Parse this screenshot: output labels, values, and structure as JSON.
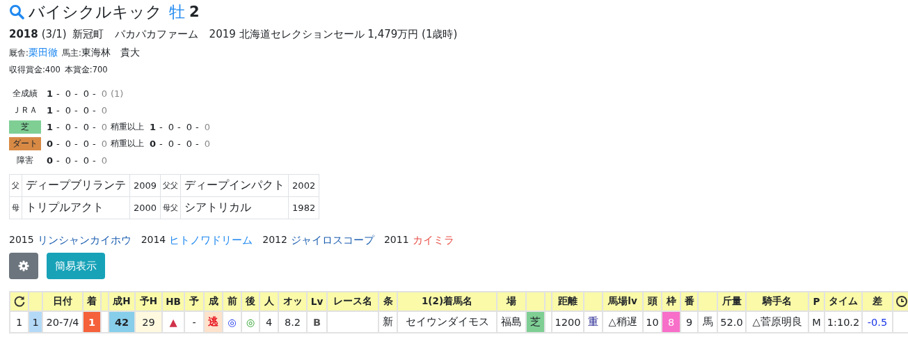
{
  "header": {
    "name": "バイシクルキック",
    "sex": "牡",
    "age": "2"
  },
  "profile": {
    "year": "2018",
    "birthday": "(3/1)",
    "town": "新冠町",
    "farm": "パカパカファーム",
    "sale": "2019 北海道セレクションセール 1,479万円 (1歳時)"
  },
  "stable": {
    "trainer_label": "厩舎:",
    "trainer": "栗田徹",
    "owner_label": "馬主:",
    "owner": "東海林　貴大"
  },
  "prize": {
    "earned": "収得賞金:400",
    "total": "本賞金:700"
  },
  "record_separator": "-",
  "records": [
    {
      "label": "全成績",
      "kind": "plain",
      "counts": [
        "1",
        "0",
        "0",
        "0"
      ],
      "note": "(1)"
    },
    {
      "label": "ＪＲＡ",
      "kind": "plain",
      "counts": [
        "1",
        "0",
        "0",
        "0"
      ]
    },
    {
      "label": "芝",
      "kind": "turf",
      "counts": [
        "1",
        "0",
        "0",
        "0"
      ],
      "heavy": {
        "label": "稍重以上",
        "counts": [
          "1",
          "0",
          "0",
          "0"
        ]
      }
    },
    {
      "label": "ダート",
      "kind": "dirt",
      "counts": [
        "0",
        "0",
        "0",
        "0"
      ],
      "heavy": {
        "label": "稍重以上",
        "counts": [
          "0",
          "0",
          "0",
          "0"
        ]
      }
    },
    {
      "label": "障害",
      "kind": "plain",
      "counts": [
        "0",
        "0",
        "0",
        "0"
      ]
    }
  ],
  "pedigree": [
    [
      "父",
      "ディープブリランテ",
      "2009",
      "父父",
      "ディープインパクト",
      "2002"
    ],
    [
      "母",
      "トリプルアクト",
      "2000",
      "母父",
      "シアトリカル",
      "1982"
    ]
  ],
  "siblings": [
    {
      "year": "2015",
      "name": "リンシャンカイホウ",
      "color": "#1d5fb0"
    },
    {
      "year": "2014",
      "name": "ヒトノワドリーム",
      "color": "#1e88f0"
    },
    {
      "year": "2012",
      "name": "ジャイロスコープ",
      "color": "#1d5fb0"
    },
    {
      "year": "2011",
      "name": "カイミラ",
      "color": "#e8524a"
    }
  ],
  "buttons": {
    "simple": "簡易表示"
  },
  "table": {
    "columns": [
      {
        "kind": "reload"
      },
      {},
      {
        "label": "日付"
      },
      {
        "label": "着"
      },
      {},
      {
        "label": "成H"
      },
      {
        "label": "予H"
      },
      {
        "label": "HB"
      },
      {
        "label": "予"
      },
      {
        "label": "成"
      },
      {
        "label": "前"
      },
      {
        "label": "後"
      },
      {
        "label": "人"
      },
      {
        "label": "オッ"
      },
      {
        "label": "Lv"
      },
      {
        "label": "レース名"
      },
      {
        "label": "条"
      },
      {
        "label": "1(2)着馬名"
      },
      {
        "label": "場"
      },
      {},
      {},
      {
        "label": "距離"
      },
      {},
      {
        "label": "馬場lv"
      },
      {
        "label": "頭"
      },
      {
        "label": "枠"
      },
      {
        "label": "番"
      },
      {},
      {
        "label": "斤量"
      },
      {
        "label": "騎手名"
      },
      {
        "label": "P"
      },
      {
        "label": "タイム"
      },
      {
        "label": "差"
      },
      {
        "kind": "clock"
      }
    ],
    "rows": [
      [
        {
          "text": "1"
        },
        {
          "text": "1",
          "color": "#b3d9f7"
        },
        {
          "text": "20-7/4"
        },
        {
          "text": "1",
          "color": "#f4613a",
          "kind": "light"
        },
        {},
        {
          "text": "42",
          "color": "#87ceea",
          "kind": "strong"
        },
        {
          "text": "29",
          "color": "#fff9e0"
        },
        {
          "text": "▲",
          "kind": "red"
        },
        {
          "text": "-"
        },
        {
          "text": "逃",
          "color": "#fde2cc",
          "kind": "alert"
        },
        {
          "text": "◎",
          "kind": "blue"
        },
        {
          "text": "◎",
          "kind": "green"
        },
        {
          "text": "4"
        },
        {
          "text": "8.2"
        },
        {
          "text": "B",
          "kind": "muted"
        },
        {},
        {
          "text": "新"
        },
        {
          "text": "セイウンダイモス"
        },
        {
          "text": "福島"
        },
        {
          "text": "芝",
          "color": "#7fcf95"
        },
        {},
        {
          "text": "1200"
        },
        {
          "text": "重",
          "kind": "navy"
        },
        {
          "text": "△稍遅"
        },
        {
          "text": "10"
        },
        {
          "text": "8",
          "color": "#f76fc8",
          "kind": "white"
        },
        {
          "text": "9"
        },
        {
          "text": "馬"
        },
        {
          "text": "52.0"
        },
        {
          "text": "△菅原明良"
        },
        {
          "text": "M"
        },
        {
          "text": "1:10.2"
        },
        {
          "text": "-0.5",
          "kind": "blue"
        },
        {}
      ]
    ]
  }
}
